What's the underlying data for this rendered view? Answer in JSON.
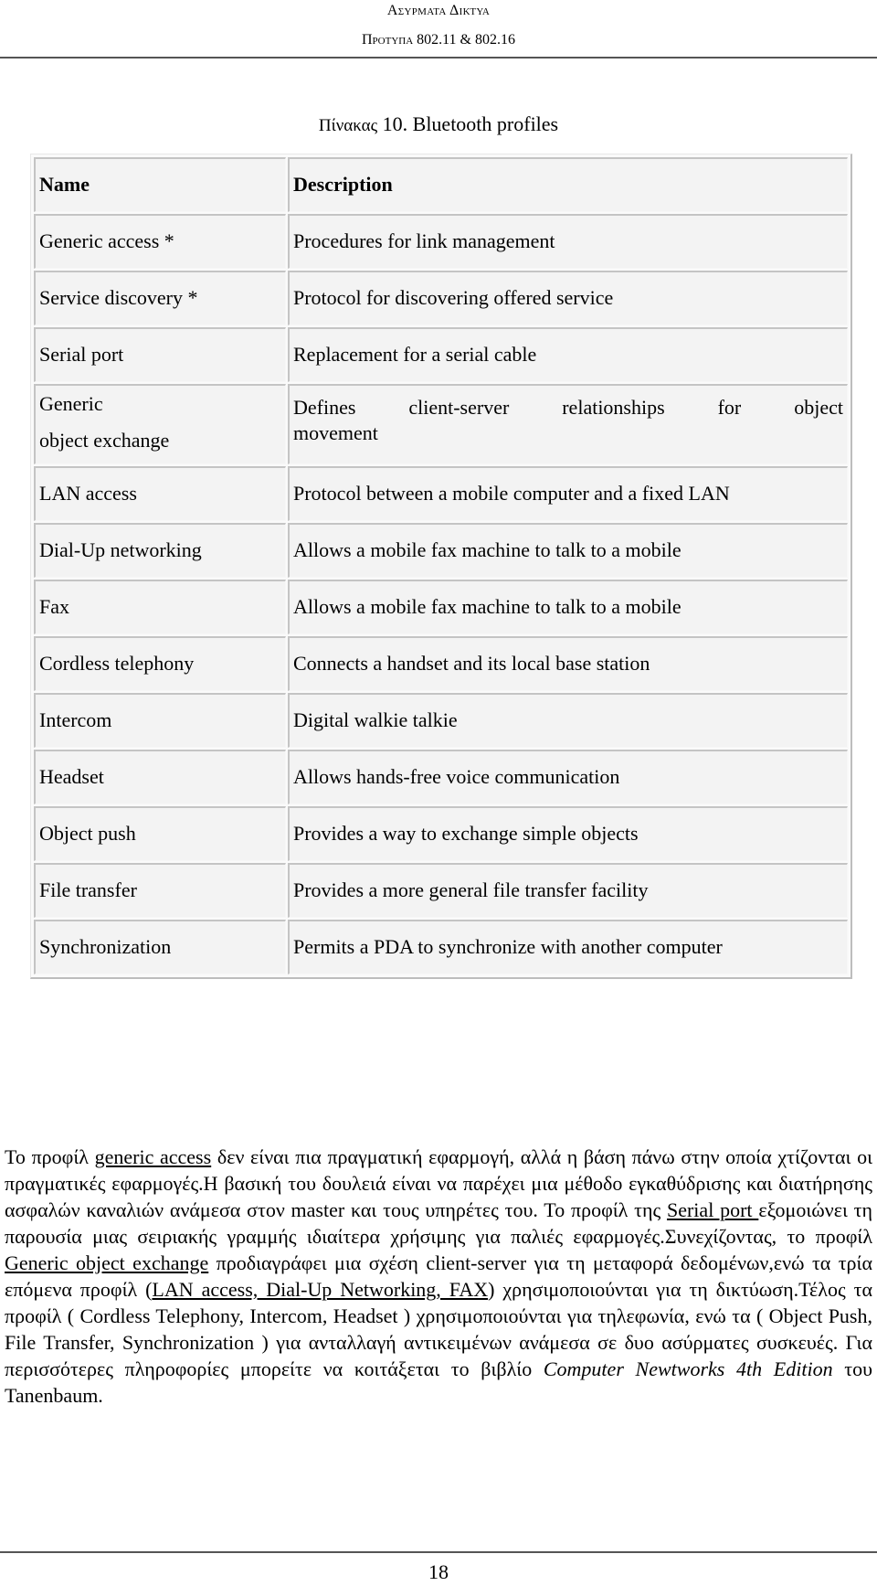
{
  "header": {
    "title": "Ασυρματα Δικτυα",
    "subtitle": "Προτυπα 802.11 & 802.16"
  },
  "caption": {
    "label": "Πίνακας",
    "number": "10.",
    "title": "Bluetooth profiles"
  },
  "table": {
    "columns": [
      "Name",
      "Description"
    ],
    "rows": [
      {
        "name": "Generic access *",
        "description": "Procedures for link management"
      },
      {
        "name": "Service discovery *",
        "description": "Protocol for discovering offered service"
      },
      {
        "name": "Serial port",
        "description": "Replacement for a serial cable"
      },
      {
        "name_line1": "Generic",
        "name_line2": "object exchange",
        "description": "Defines client-server relationships for object movement",
        "description_words": [
          "Defines",
          "client-server",
          "relationships",
          "for",
          "object"
        ],
        "description_line2": "movement"
      },
      {
        "name": "LAN access",
        "description": "Protocol between a mobile computer and a fixed LAN"
      },
      {
        "name": "Dial-Up networking",
        "description": "Allows a mobile fax machine to talk to a mobile"
      },
      {
        "name": "Fax",
        "description": "Allows a mobile fax machine to talk to a mobile"
      },
      {
        "name": "Cordless telephony",
        "description": "Connects a handset and its local base station"
      },
      {
        "name": "Intercom",
        "description": "Digital walkie talkie"
      },
      {
        "name": "Headset",
        "description": "Allows hands-free voice communication"
      },
      {
        "name": "Object push",
        "description": "Provides a way to exchange simple objects"
      },
      {
        "name": "File transfer",
        "description": "Provides a more general file transfer facility"
      },
      {
        "name": "Synchronization",
        "description": "Permits a PDA to synchronize with another computer"
      }
    ]
  },
  "paragraph": {
    "p1": "Το προφίλ ",
    "link_generic_access": "generic access",
    "p2": " δεν είναι πια πραγματική εφαρμογή, αλλά η βάση πάνω στην οποία χτίζονται οι πραγματικές εφαρμογές.Η βασική του δουλειά είναι να παρέχει μια μέθοδο εγκαθύδρισης και διατήρησης ασφαλών καναλιών ανάμεσα στον master και τους υπηρέτες του. Το προφίλ της ",
    "link_serial_port": "Serial port ",
    "p3": "εξομοιώνει τη παρουσία μιας σειριακής γραμμής ιδιαίτερα χρήσιμης για παλιές εφαρμογές.Συνεχίζοντας, το προφίλ ",
    "link_generic_object_exchange": "Generic object exchange",
    "p4": " προδιαγράφει μια σχέση client-server για τη μεταφορά δεδομένων,ενώ τα τρία επόμενα προφίλ (",
    "link_networking": "LAN access, Dial-Up Networking, FAX",
    "p5": ") χρησιμοποιούνται για τη δικτύωση.Τέλος τα προφίλ ( Cordless Telephony, Intercom, Headset ) χρησιμοποιούνται για τηλεφωνία, ενώ τα ( Object Push, File Transfer, Synchronization ) για ανταλλαγή αντικειμένων ανάμεσα σε δυο ασύρματες συσκευές. Για περισσότερες πληροφορίες μπορείτε να κοιτάξεται το βιβλίο ",
    "book_title": "Computer Newtworks 4th Edition",
    "p6": " του Tanenbaum."
  },
  "footer": {
    "page_number": "18"
  }
}
